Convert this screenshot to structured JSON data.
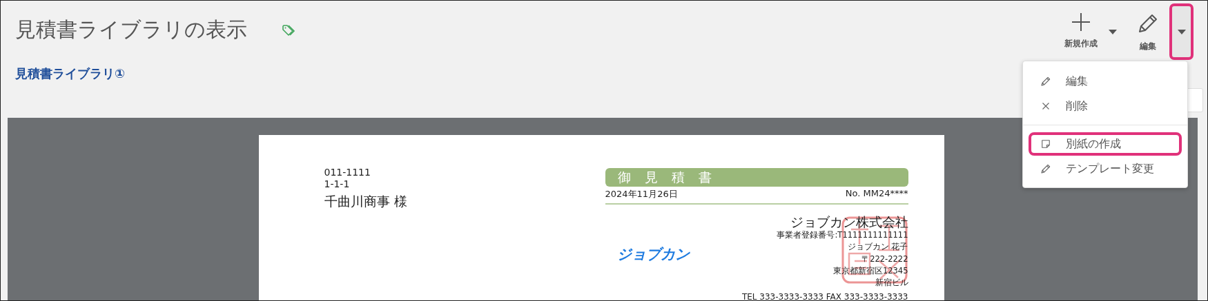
{
  "page": {
    "title": "見積書ライブラリの表示",
    "breadcrumb": "見積書ライブラリ①"
  },
  "toolbar": [
    {
      "kind": "new",
      "label": "新規作成",
      "has_caret": true
    },
    {
      "kind": "edit",
      "label": "編集",
      "has_caret": false
    }
  ],
  "more_button": {
    "highlighted": true
  },
  "menu": {
    "groups": [
      [
        {
          "kind": "pencil",
          "label": "編集",
          "highlighted": false
        },
        {
          "kind": "close",
          "label": "削除",
          "highlighted": false
        }
      ],
      [
        {
          "kind": "note",
          "label": "別紙の作成",
          "highlighted": true
        },
        {
          "kind": "pencil",
          "label": "テンプレート変更",
          "highlighted": false
        }
      ]
    ]
  },
  "document": {
    "recipient": {
      "postal": "011-1111",
      "address": "1-1-1",
      "name": "千曲川商事 様"
    },
    "title": "御見積書",
    "date": "2024年11月26日",
    "number": "No. MM24****",
    "logo": "ジョブカン",
    "issuer": {
      "company": "ジョブカン株式会社",
      "registration": "事業者登録番号:T1111111111111",
      "person": "ジョブカン 花子",
      "postal": "〒222-2222",
      "address": "東京都新宿区12345",
      "building": "新宿ビル",
      "contact": "TEL 333-3333-3333 FAX 333-3333-3333"
    }
  }
}
